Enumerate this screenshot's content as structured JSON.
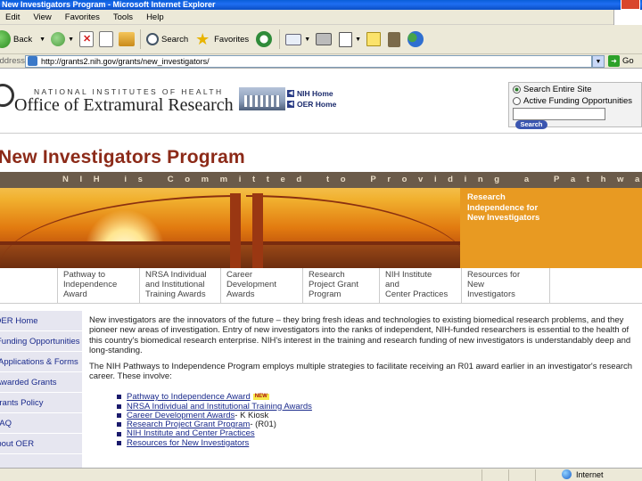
{
  "window": {
    "title": "New Investigators Program - Microsoft Internet Explorer"
  },
  "menu": [
    "Edit",
    "View",
    "Favorites",
    "Tools",
    "Help"
  ],
  "toolbar": {
    "back_label": "Back",
    "search_label": "Search",
    "favorites_label": "Favorites"
  },
  "address": {
    "label": "Address",
    "url": "http://grants2.nih.gov/grants/new_investigators/",
    "go_label": "Go"
  },
  "header": {
    "org_small": "NATIONAL INSTITUTES OF HEALTH",
    "org_big": "Office of Extramural Research",
    "links": [
      "NIH Home",
      "OER Home"
    ]
  },
  "search": {
    "option1": "Search Entire Site",
    "option2": "Active Funding Opportunities",
    "button": "Search"
  },
  "page": {
    "title": "New Investigators Program"
  },
  "banner": {
    "strip_text": "NIH is Committed to Providing a Pathway to",
    "panel_text": "Research Independence for New Investigators"
  },
  "tabs": [
    {
      "lines": [
        "Pathway to",
        "Independence",
        "Award"
      ]
    },
    {
      "lines": [
        "NRSA Individual",
        "and Institutional",
        "Training Awards"
      ]
    },
    {
      "lines": [
        "Career",
        "Development",
        "Awards"
      ]
    },
    {
      "lines": [
        "Research",
        "Project Grant",
        "Program"
      ]
    },
    {
      "lines": [
        "NIH Institute",
        "and",
        "Center Practices"
      ]
    },
    {
      "lines": [
        "Resources for",
        "New",
        "Investigators"
      ]
    }
  ],
  "leftnav": [
    "OER Home",
    "Funding Opportunities",
    "Applications & Forms",
    "Awarded Grants",
    "Grants Policy",
    "FAQ",
    "About OER"
  ],
  "content": {
    "para1": "New investigators are the innovators of the future – they bring fresh ideas and technologies to existing biomedical research problems, and they pioneer new areas of investigation. Entry of new investigators into the ranks of independent, NIH-funded researchers is essential to the health of this country's biomedical research enterprise. NIH's interest in the training and research funding of new investigators is understandably deep and long-standing.",
    "para2": "The NIH Pathways to Independence Program employs multiple strategies to facilitate receiving an R01 award earlier in an investigator's research career. These involve:",
    "links": [
      {
        "text": "Pathway to Independence Award",
        "suffix": "",
        "new": "NEW"
      },
      {
        "text": "NRSA Individual and Institutional Training Awards",
        "suffix": "",
        "new": ""
      },
      {
        "text": "Career Development Awards",
        "suffix": " - K Kiosk",
        "new": ""
      },
      {
        "text": "Research Project Grant Program",
        "suffix": " - (R01)",
        "new": ""
      },
      {
        "text": "NIH Institute and Center Practices",
        "suffix": "",
        "new": ""
      },
      {
        "text": "Resources for New Investigators",
        "suffix": "",
        "new": ""
      }
    ]
  },
  "status": {
    "zone": "Internet"
  },
  "colors": {
    "title": "#8c2a18",
    "banner_panel": "#e89a22",
    "nav_bg": "#e6e6f0",
    "link": "#1a2a8c"
  }
}
